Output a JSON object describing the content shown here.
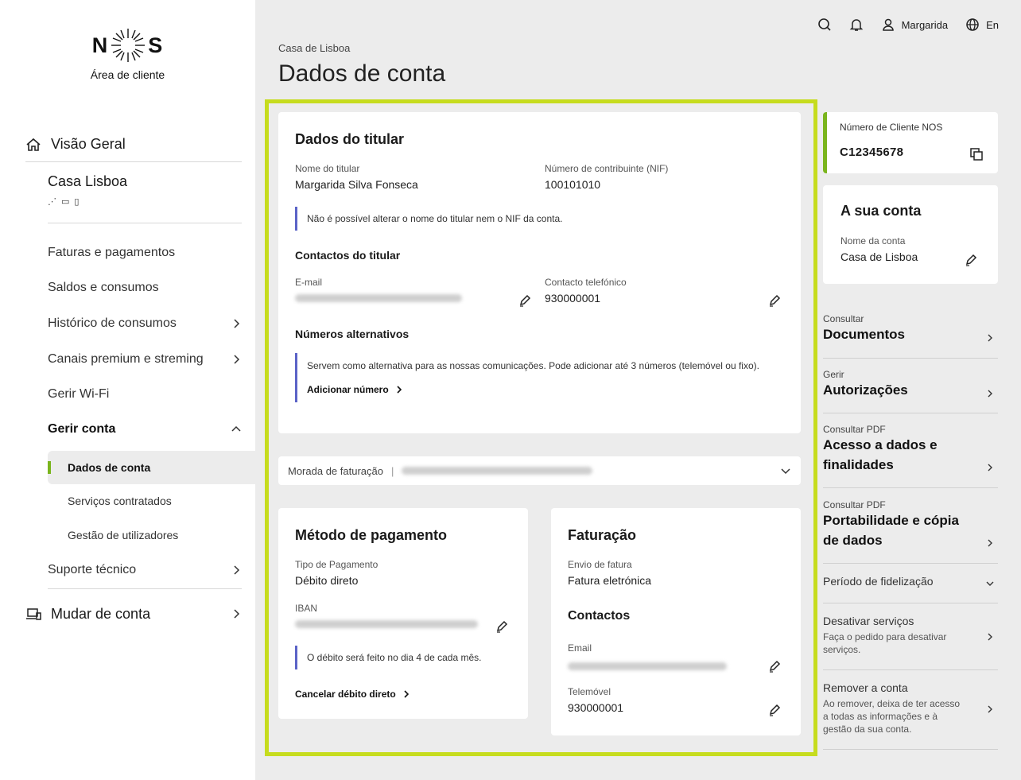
{
  "brand": {
    "logo_text_left": "N",
    "logo_text_right": "S",
    "subtitle": "Área de cliente"
  },
  "sidebar": {
    "overview": "Visão Geral",
    "account_name": "Casa Lisboa",
    "items": [
      {
        "label": "Faturas e pagamentos"
      },
      {
        "label": "Saldos e consumos"
      },
      {
        "label": "Histórico de consumos"
      },
      {
        "label": "Canais premium e streming"
      },
      {
        "label": "Gerir Wi-Fi"
      },
      {
        "label": "Gerir conta"
      },
      {
        "label": "Suporte técnico"
      }
    ],
    "sub_items": [
      {
        "label": "Dados de conta"
      },
      {
        "label": "Serviços contratados"
      },
      {
        "label": "Gestão de utilizadores"
      }
    ],
    "switch_account": "Mudar de conta"
  },
  "header": {
    "user": "Margarida",
    "language": "En"
  },
  "breadcrumb": "Casa de Lisboa",
  "page_title": "Dados de conta",
  "holder": {
    "title": "Dados do titular",
    "name_label": "Nome do titular",
    "name_value": "Margarida Silva Fonseca",
    "nif_label": "Número de contribuinte (NIF)",
    "nif_value": "100101010",
    "note": "Não é possível alterar o nome do titular nem o NIF da conta.",
    "contacts_title": "Contactos do titular",
    "email_label": "E-mail",
    "phone_label": "Contacto telefónico",
    "phone_value": "930000001",
    "alt_title": "Números alternativos",
    "alt_note": "Servem como alternativa para as nossas comunicações. Pode adicionar até 3 números (telemóvel ou fixo).",
    "add_number": "Adicionar número"
  },
  "billing_address": {
    "label": "Morada de faturação"
  },
  "payment": {
    "title": "Método de pagamento",
    "type_label": "Tipo de Pagamento",
    "type_value": "Débito direto",
    "iban_label": "IBAN",
    "note": "O débito será feito no dia 4 de cada mês.",
    "cancel": "Cancelar débito direto"
  },
  "invoicing": {
    "title": "Faturação",
    "send_label": "Envio de fatura",
    "send_value": "Fatura eletrónica",
    "contacts_title": "Contactos",
    "email_label": "Email",
    "mobile_label": "Telemóvel",
    "mobile_value": "930000001"
  },
  "right": {
    "client_label": "Número de Cliente NOS",
    "client_value": "C12345678",
    "account_title": "A sua conta",
    "account_name_label": "Nome da conta",
    "account_name_value": "Casa de Lisboa",
    "links": [
      {
        "small": "Consultar",
        "big": "Documentos"
      },
      {
        "small": "Gerir",
        "big": "Autorizações"
      },
      {
        "small": "Consultar PDF",
        "big": "Acesso a dados e finalidades"
      },
      {
        "small": "Consultar PDF",
        "big": "Portabilidade e cópia de dados"
      }
    ],
    "loyalty": "Período de fidelização",
    "deactivate_title": "Desativar serviços",
    "deactivate_desc": "Faça o pedido para desativar serviços.",
    "remove_title": "Remover a conta",
    "remove_desc": "Ao remover, deixa de ter acesso a todas as informações e à gestão da sua conta."
  }
}
